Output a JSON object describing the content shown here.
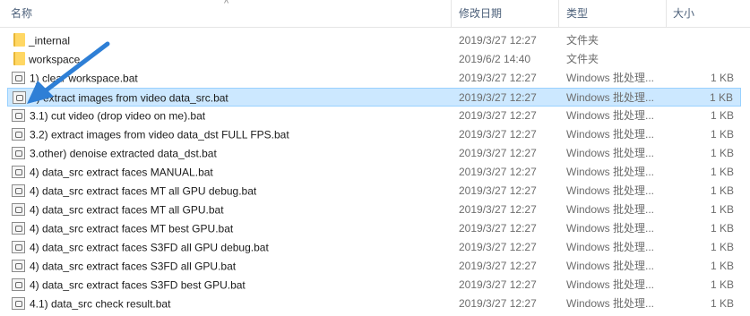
{
  "columns": {
    "name": "名称",
    "date": "修改日期",
    "type": "类型",
    "size": "大小"
  },
  "files": [
    {
      "name": "_internal",
      "date": "2019/3/27 12:27",
      "type": "文件夹",
      "size": "",
      "icon": "folder-icon"
    },
    {
      "name": "workspace",
      "date": "2019/6/2 14:40",
      "type": "文件夹",
      "size": "",
      "icon": "folder-icon"
    },
    {
      "name": "1) clear workspace.bat",
      "date": "2019/3/27 12:27",
      "type": "Windows 批处理...",
      "size": "1 KB",
      "icon": "batch-file-icon"
    },
    {
      "name": "2) extract images from video data_src.bat",
      "date": "2019/3/27 12:27",
      "type": "Windows 批处理...",
      "size": "1 KB",
      "icon": "batch-file-icon",
      "selected": true
    },
    {
      "name": "3.1) cut video (drop video on me).bat",
      "date": "2019/3/27 12:27",
      "type": "Windows 批处理...",
      "size": "1 KB",
      "icon": "batch-file-icon"
    },
    {
      "name": "3.2) extract images from video data_dst FULL FPS.bat",
      "date": "2019/3/27 12:27",
      "type": "Windows 批处理...",
      "size": "1 KB",
      "icon": "batch-file-icon"
    },
    {
      "name": "3.other) denoise extracted data_dst.bat",
      "date": "2019/3/27 12:27",
      "type": "Windows 批处理...",
      "size": "1 KB",
      "icon": "batch-file-icon"
    },
    {
      "name": "4) data_src extract faces MANUAL.bat",
      "date": "2019/3/27 12:27",
      "type": "Windows 批处理...",
      "size": "1 KB",
      "icon": "batch-file-icon"
    },
    {
      "name": "4) data_src extract faces MT all GPU debug.bat",
      "date": "2019/3/27 12:27",
      "type": "Windows 批处理...",
      "size": "1 KB",
      "icon": "batch-file-icon"
    },
    {
      "name": "4) data_src extract faces MT all GPU.bat",
      "date": "2019/3/27 12:27",
      "type": "Windows 批处理...",
      "size": "1 KB",
      "icon": "batch-file-icon"
    },
    {
      "name": "4) data_src extract faces MT best GPU.bat",
      "date": "2019/3/27 12:27",
      "type": "Windows 批处理...",
      "size": "1 KB",
      "icon": "batch-file-icon"
    },
    {
      "name": "4) data_src extract faces S3FD all GPU debug.bat",
      "date": "2019/3/27 12:27",
      "type": "Windows 批处理...",
      "size": "1 KB",
      "icon": "batch-file-icon"
    },
    {
      "name": "4) data_src extract faces S3FD all GPU.bat",
      "date": "2019/3/27 12:27",
      "type": "Windows 批处理...",
      "size": "1 KB",
      "icon": "batch-file-icon"
    },
    {
      "name": "4) data_src extract faces S3FD best GPU.bat",
      "date": "2019/3/27 12:27",
      "type": "Windows 批处理...",
      "size": "1 KB",
      "icon": "batch-file-icon"
    },
    {
      "name": "4.1) data_src check result.bat",
      "date": "2019/3/27 12:27",
      "type": "Windows 批处理...",
      "size": "1 KB",
      "icon": "batch-file-icon"
    }
  ],
  "colors": {
    "selection": "#cce8ff",
    "annotation_arrow": "#2e7fd6"
  },
  "annotation": {
    "icon": "arrow-icon"
  }
}
